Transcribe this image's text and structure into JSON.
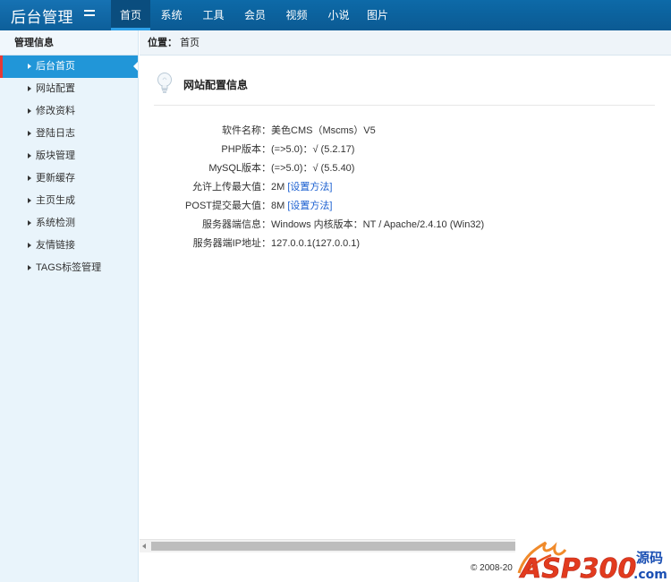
{
  "app": {
    "logo_text": "后台管理"
  },
  "nav": {
    "items": [
      {
        "label": "首页",
        "active": true
      },
      {
        "label": "系统"
      },
      {
        "label": "工具"
      },
      {
        "label": "会员"
      },
      {
        "label": "视频"
      },
      {
        "label": "小说"
      },
      {
        "label": "图片"
      }
    ]
  },
  "sidebar": {
    "title": "管理信息",
    "items": [
      {
        "label": "后台首页",
        "active": true
      },
      {
        "label": "网站配置"
      },
      {
        "label": "修改资料"
      },
      {
        "label": "登陆日志"
      },
      {
        "label": "版块管理"
      },
      {
        "label": "更新缓存"
      },
      {
        "label": "主页生成"
      },
      {
        "label": "系统检测"
      },
      {
        "label": "友情链接"
      },
      {
        "label": "TAGS标签管理"
      }
    ]
  },
  "breadcrumb": {
    "label": "位置：",
    "current": "首页"
  },
  "section": {
    "title": "网站配置信息"
  },
  "info": {
    "software_key": "软件名称：",
    "software_val": "美色CMS（Mscms）V5",
    "php_key": "PHP版本：",
    "php_val": "(=>5.0)：√  (5.2.17)",
    "mysql_key": "MySQL版本：",
    "mysql_val": "(=>5.0)：√  (5.5.40)",
    "upload_key": "允许上传最大值：",
    "upload_val": "2M ",
    "upload_link": "[设置方法]",
    "post_key": "POST提交最大值：",
    "post_val": "8M ",
    "post_link": "[设置方法]",
    "server_key": "服务器端信息：",
    "server_val": "Windows  内核版本：NT / Apache/2.4.10 (Win32)",
    "ip_key": "服务器端IP地址：",
    "ip_val": "127.0.0.1(127.0.0.1)"
  },
  "footer": {
    "text": "© 2008-20"
  },
  "watermark": {
    "text": "ASP300",
    "suffix": "源码",
    "domain": ".com"
  },
  "colors": {
    "topbar": "#0b5a93",
    "accent": "#2196d8",
    "active_border": "#e53935",
    "link": "#1a5fd0"
  }
}
